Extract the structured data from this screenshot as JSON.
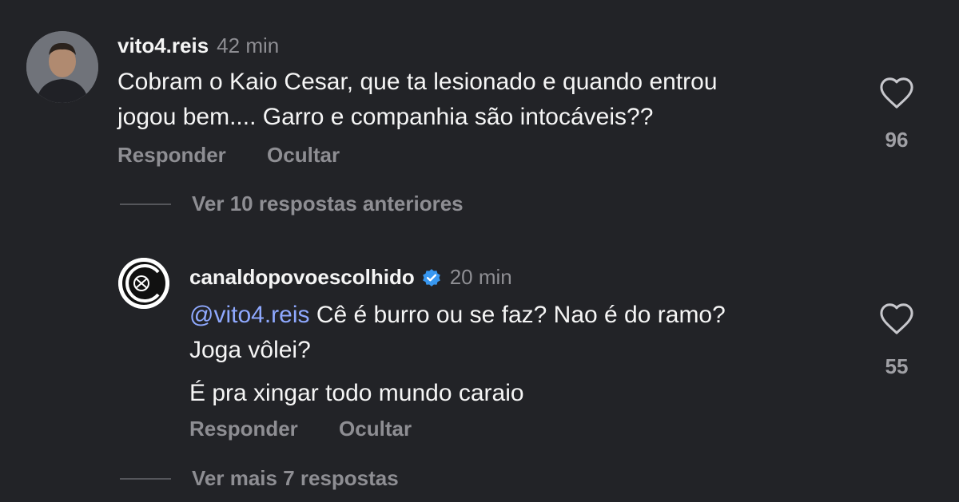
{
  "comments": [
    {
      "username": "vito4.reis",
      "time": "42 min",
      "text_lines": [
        "Cobram o Kaio Cesar, que ta lesionado e quando entrou",
        "jogou bem.... Garro e companhia são intocáveis??"
      ],
      "reply_label": "Responder",
      "hide_label": "Ocultar",
      "likes": "96"
    },
    {
      "username": "canaldopovoescolhido",
      "verified": true,
      "time": "20 min",
      "mention": "@vito4.reis",
      "text_line1_rest": " Cê é burro ou se faz? Nao é do ramo?",
      "text_line2": "Joga vôlei?",
      "text_line3": "É pra xingar todo mundo caraio",
      "reply_label": "Responder",
      "hide_label": "Ocultar",
      "likes": "55"
    }
  ],
  "view_previous": "Ver 10 respostas anteriores",
  "view_more": "Ver mais 7 respostas",
  "colors": {
    "background": "#222327",
    "mention": "#8fa9ff",
    "verified": "#3897f0",
    "muted": "#8e8e93"
  },
  "icons": {
    "like": "heart-outline-icon",
    "verified": "verified-badge-icon"
  }
}
